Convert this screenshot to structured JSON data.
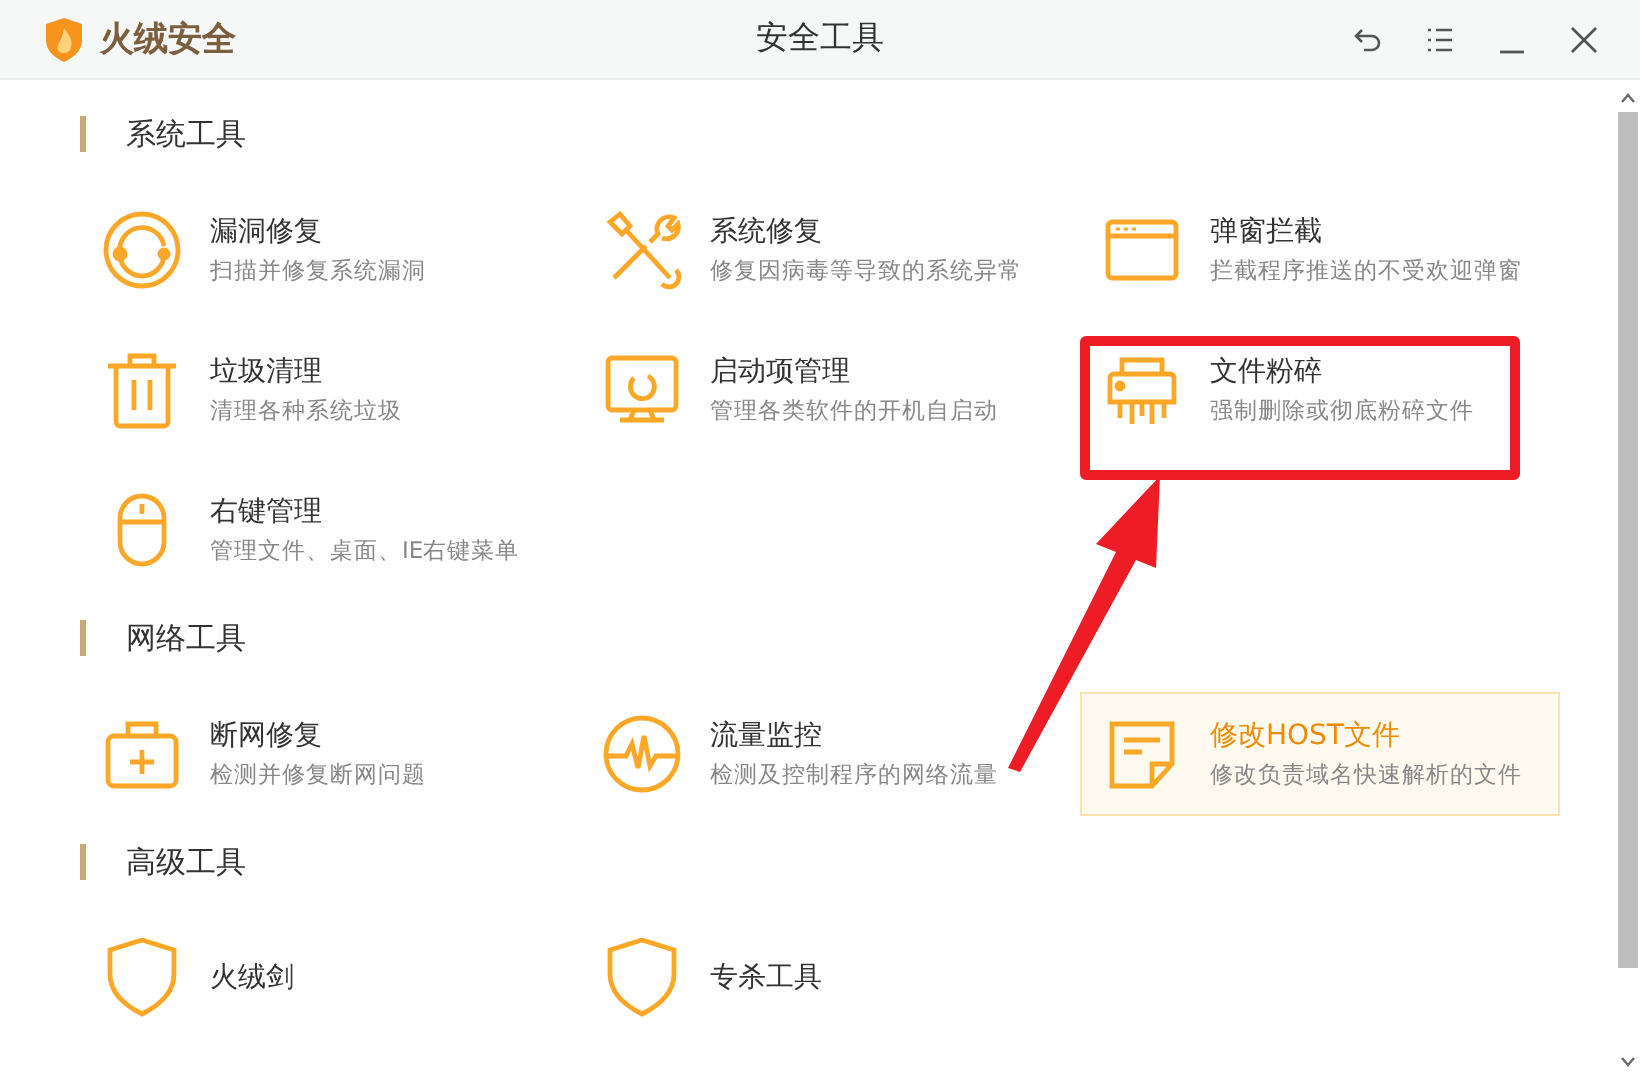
{
  "window": {
    "brand": "火绒安全",
    "title": "安全工具"
  },
  "sections": [
    {
      "title": "系统工具",
      "items": [
        {
          "title": "漏洞修复",
          "desc": "扫描并修复系统漏洞",
          "selected": false
        },
        {
          "title": "系统修复",
          "desc": "修复因病毒等导致的系统异常",
          "selected": false
        },
        {
          "title": "弹窗拦截",
          "desc": "拦截程序推送的不受欢迎弹窗",
          "selected": false
        },
        {
          "title": "垃圾清理",
          "desc": "清理各种系统垃圾",
          "selected": false
        },
        {
          "title": "启动项管理",
          "desc": "管理各类软件的开机自启动",
          "selected": false
        },
        {
          "title": "文件粉碎",
          "desc": "强制删除或彻底粉碎文件",
          "selected": false
        },
        {
          "title": "右键管理",
          "desc": "管理文件、桌面、IE右键菜单",
          "selected": false
        }
      ]
    },
    {
      "title": "网络工具",
      "items": [
        {
          "title": "断网修复",
          "desc": "检测并修复断网问题",
          "selected": false
        },
        {
          "title": "流量监控",
          "desc": "检测及控制程序的网络流量",
          "selected": false
        },
        {
          "title": "修改HOST文件",
          "desc": "修改负责域名快速解析的文件",
          "selected": true
        }
      ]
    },
    {
      "title": "高级工具",
      "items": [
        {
          "title": "火绒剑",
          "selected": false
        },
        {
          "title": "专杀工具",
          "selected": false
        }
      ]
    }
  ]
}
